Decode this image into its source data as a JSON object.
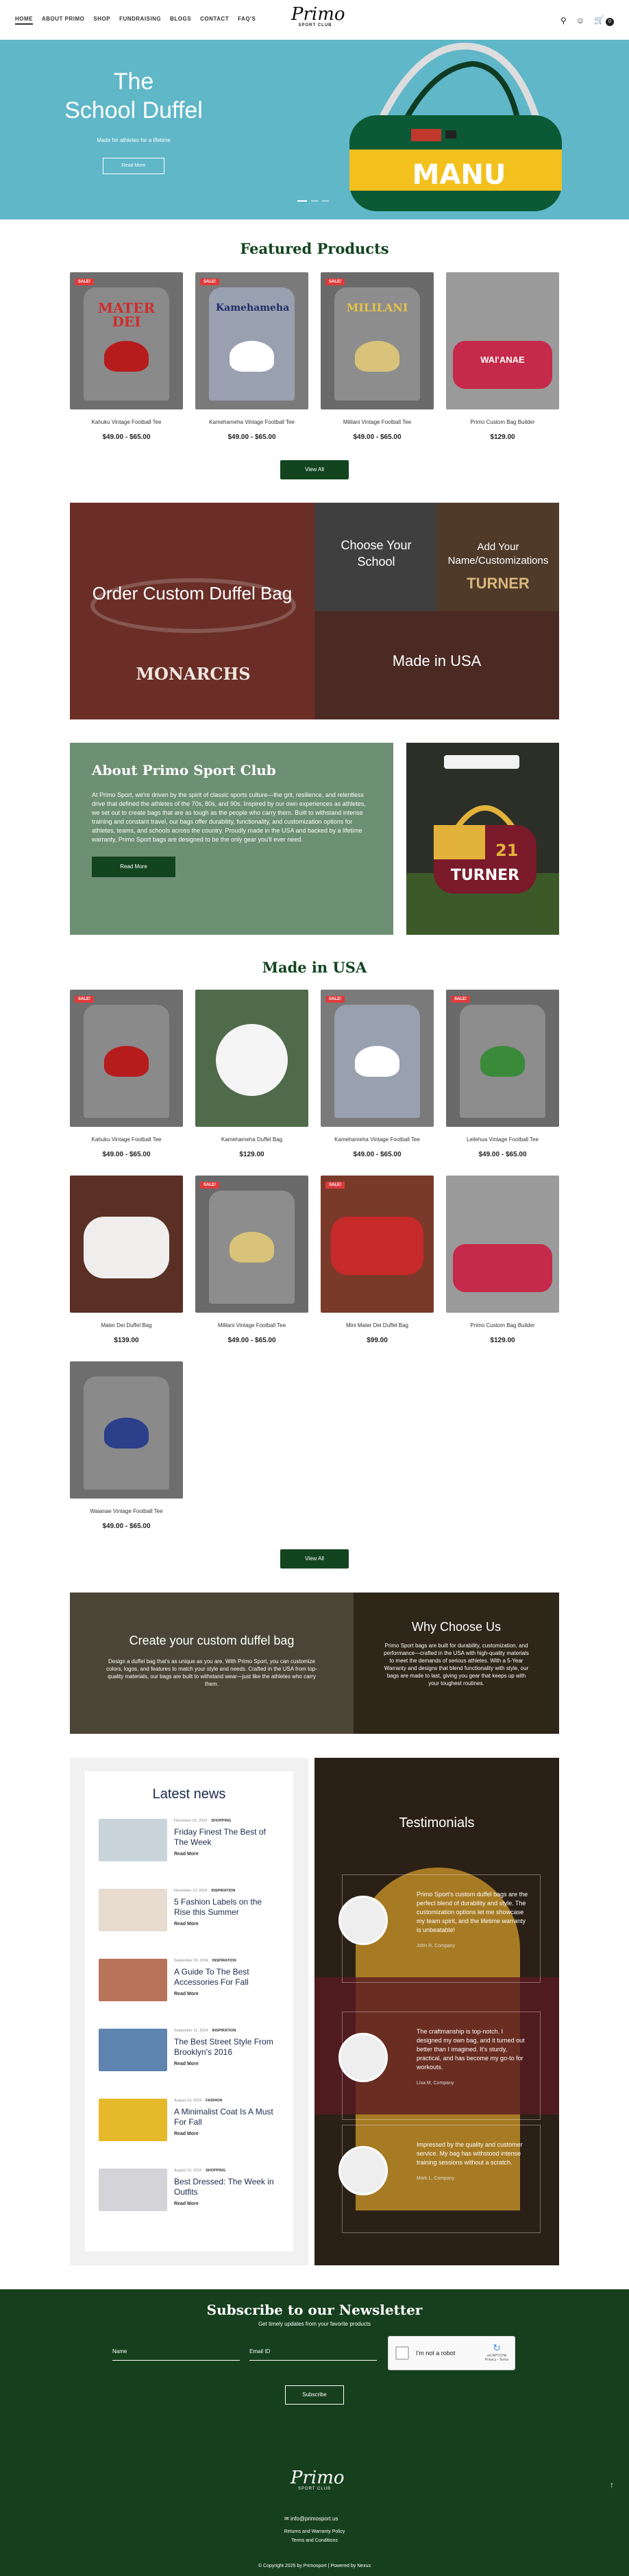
{
  "header": {
    "nav": [
      "HOME",
      "ABOUT PRIMO",
      "SHOP",
      "FUNDRAISING",
      "BLOGS",
      "CONTACT",
      "FAQ'S"
    ],
    "logo_main": "Primo",
    "logo_sub": "SPORT CLUB",
    "cart_count": "0"
  },
  "hero": {
    "title_line1": "The",
    "title_line2": "School Duffel",
    "subtitle": "Made for athletes for a lifetime",
    "button": "Read More",
    "bag_text": "MANU"
  },
  "featured": {
    "title": "Featured Products",
    "view_all": "View All",
    "items": [
      {
        "name": "Kahuku Vintage Football Tee",
        "price": "$49.00 - $65.00",
        "sale": "SALE!",
        "tee_text": "MATER DEI"
      },
      {
        "name": "Kamehameha Vintage Football Tee",
        "price": "$49.00 - $65.00",
        "sale": "SALE!",
        "tee_text": "Kamehameha"
      },
      {
        "name": "Mililani Vintage Football Tee",
        "price": "$49.00 - $65.00",
        "sale": "SALE!",
        "tee_text": "MILILANI"
      },
      {
        "name": "Primo Custom Bag Builder",
        "price": "$129.00",
        "sale": "",
        "tee_text": "WAI'ANAE"
      }
    ]
  },
  "custom_banner": {
    "main": "Order Custom Duffel Bag",
    "choose": "Choose Your School",
    "add": "Add Your Name/Customizations",
    "made": "Made in USA",
    "monarchs": "MONARCHS",
    "turner": "TURNER"
  },
  "about": {
    "title": "About Primo Sport Club",
    "text": "At Primo Sport, we're driven by the spirit of classic sports culture—the grit, resilience, and relentless drive that defined the athletes of the 70s, 80s, and 90s. Inspired by our own experiences as athletes, we set out to create bags that are as tough as the people who carry them. Built to withstand intense training and constant travel, our bags offer durability, functionality, and customization options for athletes, teams, and schools across the country. Proudly made in the USA and backed by a lifetime warranty, Primo Sport bags are designed to be the only gear you'll ever need.",
    "button": "Read More",
    "bag_text": "TURNER",
    "bag_num": "21"
  },
  "made_usa": {
    "title": "Made in USA",
    "view_all": "View All",
    "items": [
      {
        "name": "Kahuku Vintage Football Tee",
        "price": "$49.00 - $65.00",
        "sale": "SALE!"
      },
      {
        "name": "Kamehameha Duffel Bag",
        "price": "$129.00",
        "sale": ""
      },
      {
        "name": "Kamehameha Vintage Football Tee",
        "price": "$49.00 - $65.00",
        "sale": "SALE!"
      },
      {
        "name": "Leilehua Vintage Football Tee",
        "price": "$49.00 - $65.00",
        "sale": "SALE!"
      },
      {
        "name": "Mater Dei Duffel Bag",
        "price": "$139.00",
        "sale": ""
      },
      {
        "name": "Mililani Vintage Football Tee",
        "price": "$49.00 - $65.00",
        "sale": "SALE!"
      },
      {
        "name": "Mini Mater Dei Duffel Bag",
        "price": "$99.00",
        "sale": "SALE!"
      },
      {
        "name": "Primo Custom Bag Builder",
        "price": "$129.00",
        "sale": ""
      },
      {
        "name": "Waianae Vintage Football Tee",
        "price": "$49.00 - $65.00",
        "sale": ""
      }
    ]
  },
  "why": {
    "left_title": "Create your custom duffel bag",
    "left_text": "Design a duffel bag that's as unique as you are. With Primo Sport, you can customize colors, logos, and features to match your style and needs. Crafted in the USA from top-quality materials, our bags are built to withstand wear—just like the athletes who carry them.",
    "right_title": "Why Choose Us",
    "right_text": "Primo Sport bags are built for durability, customization, and performance—crafted in the USA with high-quality materials to meet the demands of serious athletes. With a 5-Year Warranty and designs that blend functionality with style, our bags are made to last, giving you gear that keeps up with your toughest routines."
  },
  "news": {
    "title": "Latest news",
    "read_more": "Read More",
    "items": [
      {
        "date": "December 02, 2024",
        "cat": "SHOPPING",
        "title": "Friday Finest The Best of The Week"
      },
      {
        "date": "November 13, 2024",
        "cat": "INSPIRATION",
        "title": "5 Fashion Labels on the Rise this Summer"
      },
      {
        "date": "September 30, 2024",
        "cat": "INSPIRATION",
        "title": "A Guide To The Best Accessories For Fall"
      },
      {
        "date": "September 11, 2024",
        "cat": "INSPIRATION",
        "title": "The Best Street Style From Brooklyn's 2016"
      },
      {
        "date": "August 13, 2024",
        "cat": "FASHION",
        "title": "A Minimalist Coat Is A Must For Fall"
      },
      {
        "date": "August 13, 2024",
        "cat": "SHOPPING",
        "title": "Best Dressed: The Week in Outfits"
      }
    ]
  },
  "testimonials": {
    "title": "Testimonials",
    "items": [
      {
        "quote": "Primo Sport's custom duffel bags are the perfect blend of durability and style. The customization options let me showcase my team spirit, and the lifetime warranty is unbeatable!",
        "who": "John R, Company"
      },
      {
        "quote": "The craftmanship is top-notch. I designed my own bag, and it turned out better than I imagined. It's sturdy, practical, and has become my go-to for workouts.",
        "who": "Lisa M, Company"
      },
      {
        "quote": "Impressed by the quality and customer service. My bag has withstood intense training sessions without a scratch.",
        "who": "Mark L, Company"
      }
    ]
  },
  "newsletter": {
    "title": "Subscribe to our Newsletter",
    "subtitle": "Get timely updates from your favorite products",
    "name_ph": "Name",
    "email_ph": "Email ID",
    "captcha": "I'm not a robot",
    "captcha_brand": "reCAPTCHA",
    "captcha_terms": "Privacy - Terms",
    "button": "Subscribe"
  },
  "footer": {
    "logo_main": "Primo",
    "logo_sub": "SPORT CLUB",
    "email": "info@primosport.us",
    "links": [
      "Returns and Warranty Policy",
      "Terms and Conditions"
    ],
    "copyright": "© Copyright 2025 by Primosport | Powered by Nexus"
  },
  "colors": {
    "brand_green": "#12441f",
    "hero_teal": "#5fb7c8",
    "sale_red": "#e03a3a",
    "about_green": "#6d8f73"
  }
}
